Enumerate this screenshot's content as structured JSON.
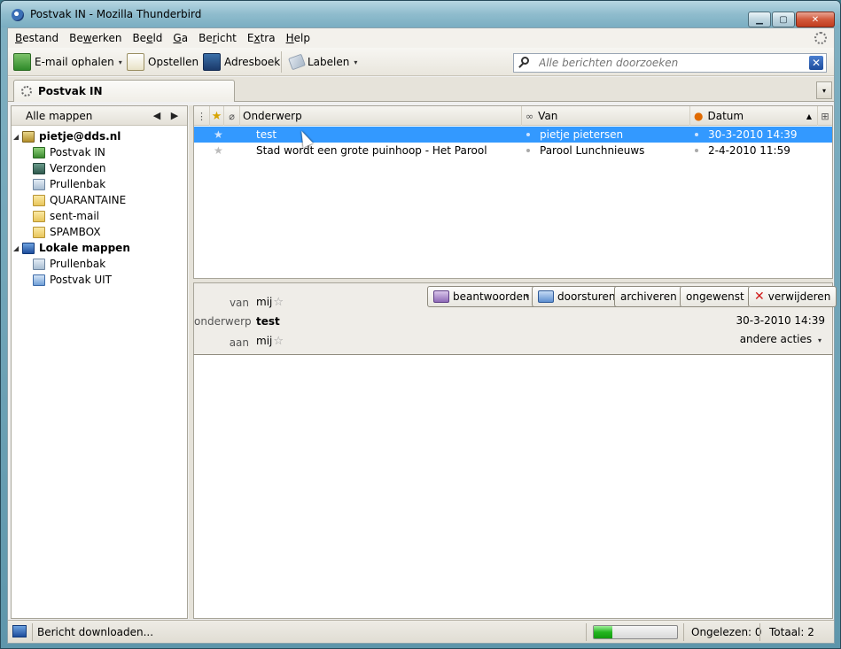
{
  "window": {
    "title": "Postvak IN - Mozilla Thunderbird",
    "controls": {
      "minimize": "▁",
      "maximize": "▢",
      "close": "✕"
    }
  },
  "menubar": [
    {
      "label": "Bestand",
      "key": "B",
      "rest": "estand"
    },
    {
      "label": "Bewerken",
      "key": "w",
      "pre": "Be",
      "rest": "erken"
    },
    {
      "label": "Beeld",
      "key": "e",
      "pre": "Be",
      "rest": "ld"
    },
    {
      "label": "Ga",
      "key": "G",
      "rest": "a"
    },
    {
      "label": "Bericht",
      "key": "r",
      "pre": "Be",
      "rest": "icht"
    },
    {
      "label": "Extra",
      "key": "x",
      "pre": "E",
      "rest": "tra"
    },
    {
      "label": "Help",
      "key": "H",
      "rest": "elp"
    }
  ],
  "toolbar": {
    "get_mail": "E-mail ophalen",
    "compose": "Opstellen",
    "address_book": "Adresboek",
    "tag": "Labelen",
    "search_placeholder": "Alle berichten doorzoeken",
    "clear_glyph": "✕"
  },
  "tab": {
    "label": "Postvak IN",
    "menu_glyph": "▾"
  },
  "folders": {
    "header": "Alle mappen",
    "prev_glyph": "◀",
    "next_glyph": "▶",
    "items": [
      {
        "label": "pietje@dds.nl",
        "icon": "account-icon",
        "level": 0,
        "bold": true,
        "twisty": "◢"
      },
      {
        "label": "Postvak IN",
        "icon": "inbox-icon",
        "level": 1
      },
      {
        "label": "Verzonden",
        "icon": "sent-icon",
        "level": 1
      },
      {
        "label": "Prullenbak",
        "icon": "trash-icon",
        "level": 1
      },
      {
        "label": "QUARANTAINE",
        "icon": "folder-icon",
        "level": 1
      },
      {
        "label": "sent-mail",
        "icon": "folder-icon",
        "level": 1
      },
      {
        "label": "SPAMBOX",
        "icon": "folder-icon",
        "level": 1
      },
      {
        "label": "Lokale mappen",
        "icon": "local-folders-icon",
        "level": 0,
        "bold": true,
        "twisty": "◢"
      },
      {
        "label": "Prullenbak",
        "icon": "trash-icon",
        "level": 1
      },
      {
        "label": "Postvak UIT",
        "icon": "outbox-icon",
        "level": 1
      }
    ]
  },
  "message_list": {
    "columns": {
      "subject": "Onderwerp",
      "from": "Van",
      "date": "Datum"
    },
    "sort_glyph": "▲",
    "rows": [
      {
        "subject": "test",
        "from": "pietje pietersen",
        "date": "30-3-2010 14:39",
        "selected": true
      },
      {
        "subject": "Stad wordt een grote puinhoop - Het Parool",
        "from": "Parool Lunchnieuws",
        "date": "2-4-2010 11:59",
        "selected": false
      }
    ]
  },
  "message_header": {
    "from_label": "van",
    "from_value": "mij",
    "subject_label": "onderwerp",
    "subject_value": "test",
    "to_label": "aan",
    "to_value": "mij",
    "date": "30-3-2010 14:39",
    "buttons": {
      "reply": "beantwoorden",
      "forward": "doorsturen",
      "archive": "archiveren",
      "junk": "ongewenst",
      "delete": "verwijderen"
    },
    "more_actions": "andere acties"
  },
  "statusbar": {
    "text": "Bericht downloaden...",
    "progress": 0.22,
    "unread": "Ongelezen: 0",
    "total": "Totaal: 2"
  }
}
